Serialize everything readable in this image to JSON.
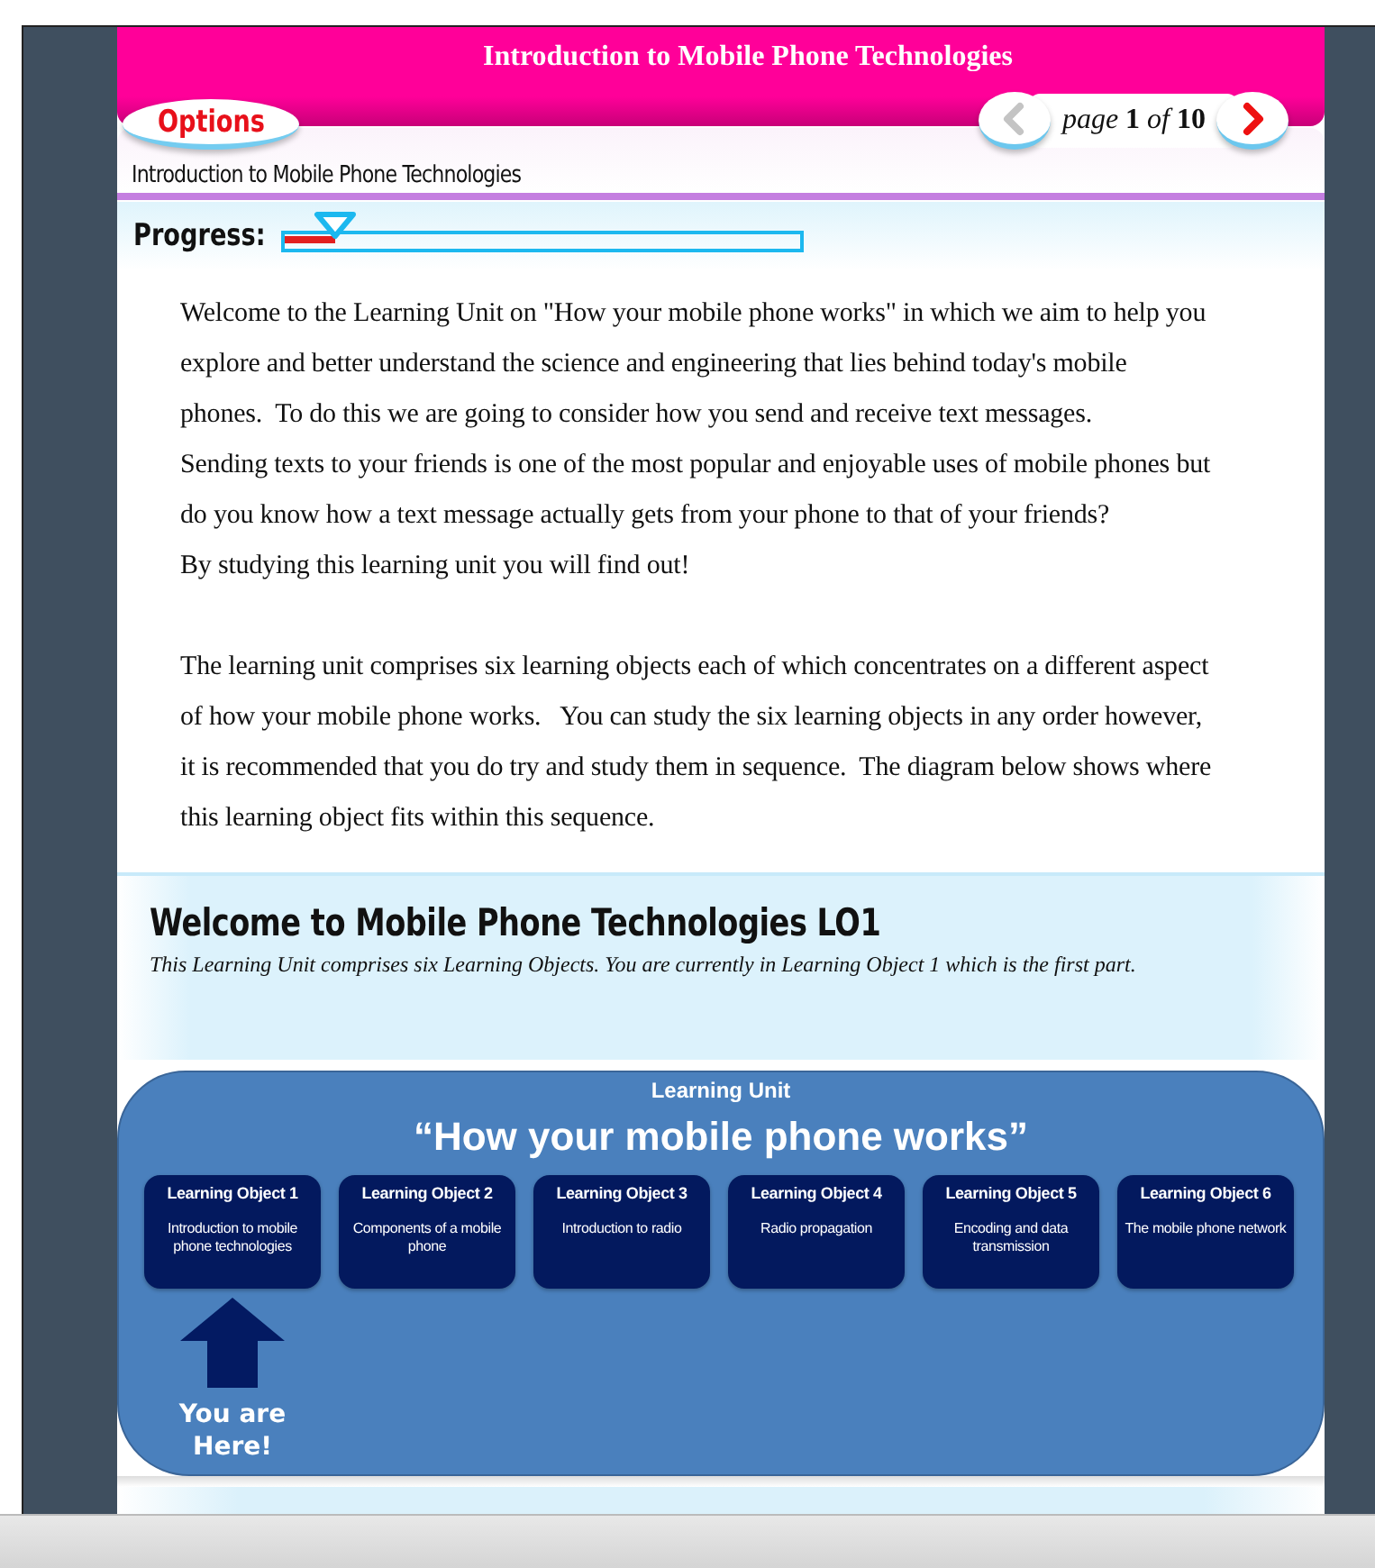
{
  "header": {
    "title": "Introduction to Mobile Phone Technologies"
  },
  "options_button": {
    "label": "Options"
  },
  "pager": {
    "prev_disabled": true,
    "next_disabled": false,
    "label": "*page* **1** *of* **10**"
  },
  "subtitle": "Introduction to Mobile Phone Technologies",
  "progress": {
    "label": "Progress:",
    "level": 0.1
  },
  "paragraphs": [
    [
      "Welcome to the Learning Unit on \"How your mobile phone works\" in which we aim to help you explore and better understand the science and engineering that lies behind today's mobile phones.  To do this we are going to consider how you send and receive text messages.",
      "Sending texts to your friends is one of the most popular and enjoyable uses of mobile phones but do you know how a text message actually gets from your phone to that of your friends?",
      "By studying this learning unit you will find out!"
    ],
    [
      "The learning unit comprises six learning objects each of which concentrates on a different aspect of how your mobile phone works.   You can study the six learning objects in any order however, it is recommended that you do try and study them in sequence.  The diagram below shows where this learning object fits within this sequence."
    ]
  ],
  "section": {
    "heading": "Welcome to Mobile Phone Technologies LO1",
    "intro": "This Learning Unit comprises six Learning Objects.  You are currently in Learning Object 1 which is the first part."
  },
  "diagram": {
    "caption": "Learning Unit",
    "title": "“How your mobile phone works”",
    "marker": "You are Here!",
    "objects": [
      {
        "name": "Learning Object 1",
        "topic": "Introduction to mobile phone technologies",
        "selected": true
      },
      {
        "name": "Learning Object 2",
        "topic": "Components of a mobile phone",
        "selected": false
      },
      {
        "name": "Learning Object 3",
        "topic": "Introduction to radio",
        "selected": false
      },
      {
        "name": "Learning Object 4",
        "topic": "Radio propagation",
        "selected": false
      },
      {
        "name": "Learning Object 5",
        "topic": "Encoding and data transmission",
        "selected": false
      },
      {
        "name": "Learning Object 6",
        "topic": "The mobile phone network",
        "selected": false
      }
    ]
  }
}
